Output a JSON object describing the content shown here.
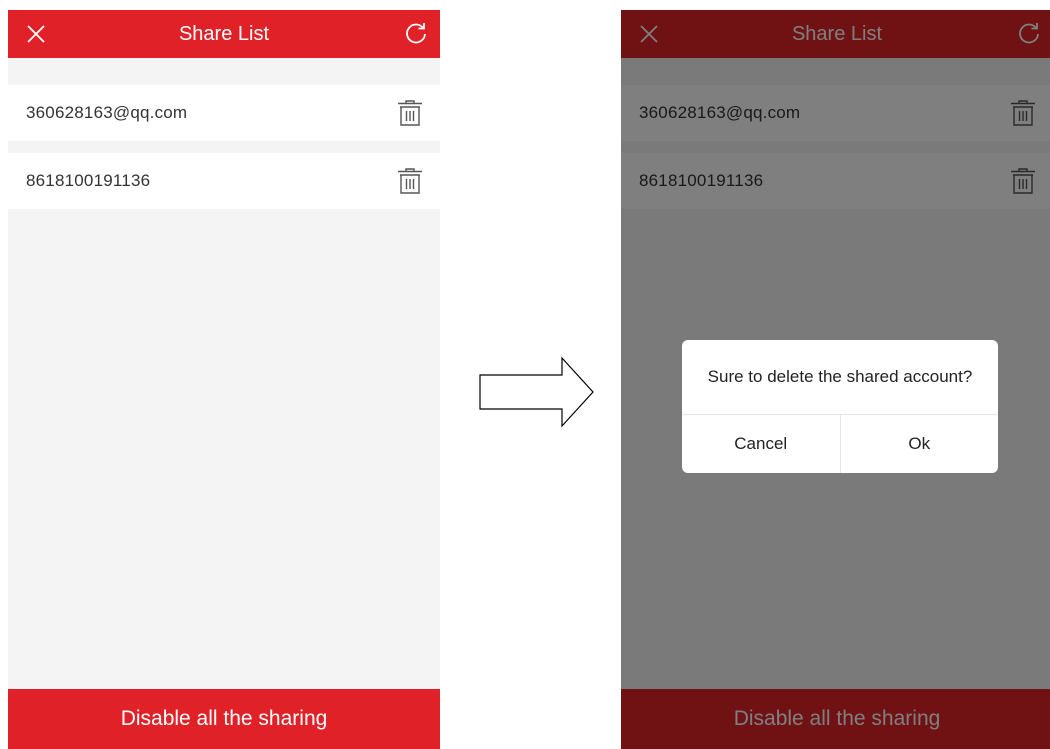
{
  "header": {
    "title": "Share List"
  },
  "icons": {
    "close": "close-icon",
    "refresh": "refresh-icon",
    "delete": "trash-icon",
    "transition": "right-arrow-icon"
  },
  "share_list": {
    "items": [
      {
        "account": "360628163@qq.com"
      },
      {
        "account": "8618100191136"
      }
    ]
  },
  "footer": {
    "disable_label": "Disable all the sharing"
  },
  "dialog": {
    "message": "Sure to delete the shared account?",
    "cancel_label": "Cancel",
    "ok_label": "Ok"
  },
  "colors": {
    "brand_red": "#e02228",
    "background": "#f4f4f4",
    "overlay": "rgba(0,0,0,0.5)"
  }
}
